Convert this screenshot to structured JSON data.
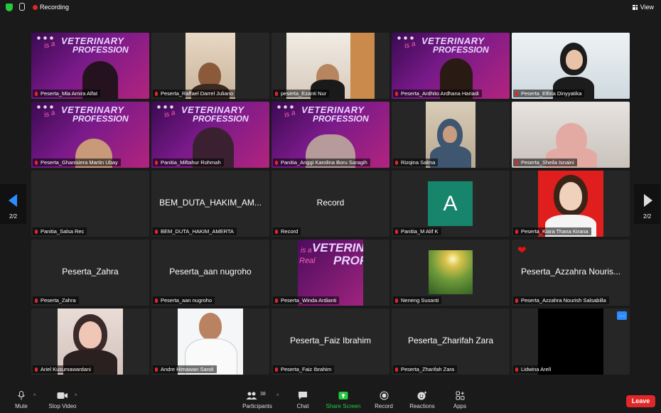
{
  "topbar": {
    "recording_label": "Recording",
    "view_label": "View"
  },
  "banner": {
    "line0": "is a",
    "line1": "VETERINARY",
    "line2": "PROFESSION",
    "line_real": "Real"
  },
  "tiles": [
    {
      "label": "Peserta_Mia Amira Alfat"
    },
    {
      "label": "Peserta_Raffael Darrel Juliano"
    },
    {
      "label": "peserta_Ezanti Nur"
    },
    {
      "label": "Peserta_Ardhito Ardhana Hariadi"
    },
    {
      "label": "Peserta_Elfina Dinyyatika"
    },
    {
      "label": "Peserta_Ghanisiera Martin Ubay"
    },
    {
      "label": "Panitia_Miftahur Rohmah"
    },
    {
      "label": "Panitia_Anggi Karolina Boru Saragih"
    },
    {
      "label": "Rizqina Salma"
    },
    {
      "label": "Peserta_Sheila Isnaini"
    },
    {
      "label": "Panitia_Salsa Rec"
    },
    {
      "label": "BEM_DUTA_HAKIM_AMERTA",
      "big": "BEM_DUTA_HAKIM_AM..."
    },
    {
      "label": "Record",
      "big": "Record"
    },
    {
      "label": "Panitia_M Alif K",
      "avatar": "A"
    },
    {
      "label": "Peserta_Kiara Thana Kirana"
    },
    {
      "label": "Peserta_Zahra",
      "big": "Peserta_Zahra"
    },
    {
      "label": "Peserta_aan nugroho",
      "big": "Peserta_aan nugroho"
    },
    {
      "label": "Peserta_Winda Ardianti"
    },
    {
      "label": "Neneng Susanti"
    },
    {
      "label": "Peserta_Azzahra Nourish Salsabilla",
      "big": "Peserta_Azzahra Nouris..."
    },
    {
      "label": "Ariel Kusumawardani"
    },
    {
      "label": "Andre Himawan Sandi"
    },
    {
      "label": "Peserta_Faiz Ibrahim",
      "big": "Peserta_Faiz Ibrahim"
    },
    {
      "label": "Peserta_Zharifah Zara",
      "big": "Peserta_Zharifah Zara"
    },
    {
      "label": "Lidwina Arell"
    }
  ],
  "pager": {
    "left_page": "2/2",
    "right_page": "2/2"
  },
  "toolbar": {
    "mute": "Mute",
    "stop_video": "Stop Video",
    "participants": "Participants",
    "participants_count": "38",
    "chat": "Chat",
    "share_screen": "Share Screen",
    "record": "Record",
    "reactions": "Reactions",
    "apps": "Apps",
    "leave": "Leave"
  },
  "colors": {
    "accent_green": "#27c93f",
    "leave_red": "#e02828",
    "pager_blue": "#2d8cff"
  }
}
